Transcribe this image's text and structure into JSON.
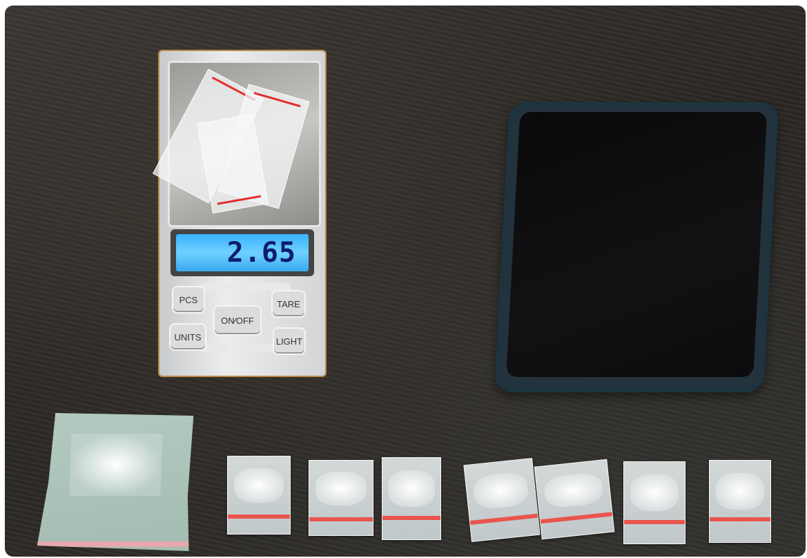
{
  "scale": {
    "display_reading": "2.65",
    "buttons": {
      "pcs": "PCS",
      "tare": "TARE",
      "on_off": "ON⁄OFF",
      "units": "UNITS",
      "light": "LIGHT"
    }
  },
  "colors": {
    "display_backlight": "#39b2ff",
    "seal_red": "#e9554d",
    "table": "#2a2724"
  }
}
